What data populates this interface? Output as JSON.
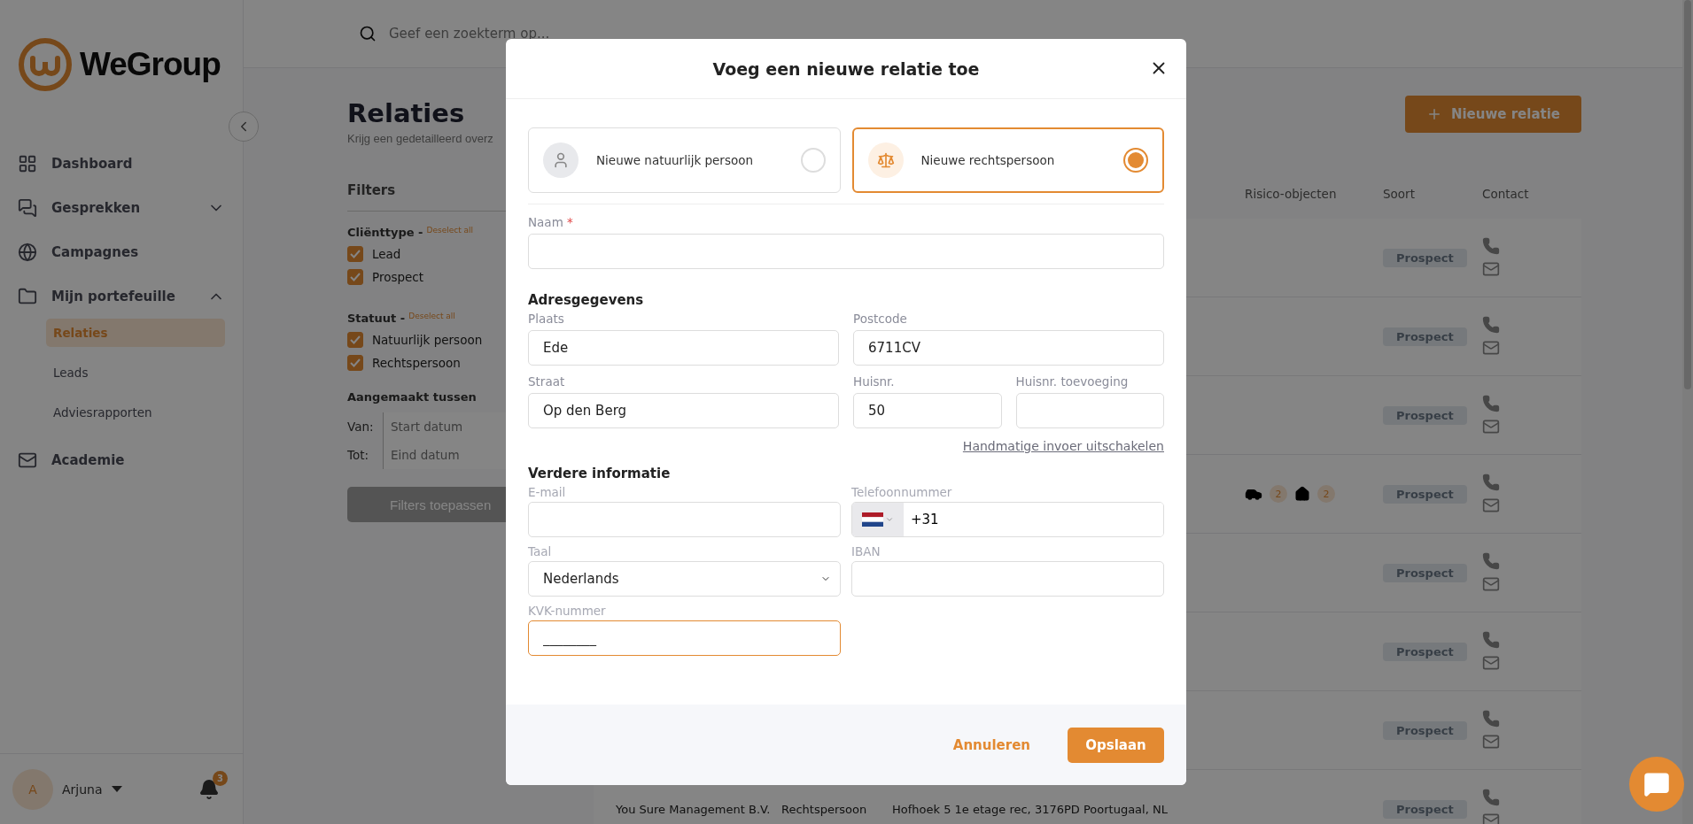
{
  "sidebar": {
    "logo": "WeGroup",
    "items": [
      {
        "kind": "dashboard",
        "label": "Dashboard",
        "selected": false
      },
      {
        "kind": "chats",
        "label": "Gesprekken",
        "selected": false,
        "expanded": false
      },
      {
        "kind": "globe",
        "label": "Campagnes",
        "selected": false
      },
      {
        "kind": "folder",
        "label": "Mijn portefeuille",
        "selected": false,
        "expanded": true,
        "children": [
          {
            "label": "Relaties",
            "selected": true
          },
          {
            "label": "Leads",
            "selected": false
          },
          {
            "label": "Adviesrapporten",
            "selected": false
          }
        ]
      },
      {
        "kind": "academy",
        "label": "Academie",
        "selected": false
      }
    ],
    "user": {
      "initial": "A",
      "name": "Arjuna"
    },
    "notifications": "3"
  },
  "search": {
    "placeholder": "Geef een zoekterm op..."
  },
  "page": {
    "title": "Relaties",
    "subtitle": "Krijg een gedetailleerd overz",
    "new_button": "Nieuwe relatie"
  },
  "filters": {
    "title": "Filters",
    "groups": [
      {
        "title": "Cliënttype -",
        "deselect": "Deselect all",
        "options": [
          {
            "label": "Lead",
            "checked": true
          },
          {
            "label": "Prospect",
            "checked": true
          }
        ]
      },
      {
        "title": "Statuut -",
        "deselect": "Deselect all",
        "options": [
          {
            "label": "Natuurlijk persoon",
            "checked": true
          },
          {
            "label": "Rechtspersoon",
            "checked": true
          }
        ]
      }
    ],
    "date_title": "Aangemaakt tussen",
    "dates": [
      {
        "label": "Van:",
        "placeholder": "Start datum"
      },
      {
        "label": "Tot:",
        "placeholder": "Eind datum"
      }
    ],
    "apply": "Filters toepassen"
  },
  "table": {
    "columns": [
      "Risico-objecten",
      "Soort",
      "Contact"
    ],
    "rows": [
      {
        "soort": "Prospect"
      },
      {
        "soort": "Prospect"
      },
      {
        "soort": "Prospect"
      },
      {
        "soort": "Prospect",
        "risks": [
          {
            "kind": "car",
            "count": "2"
          },
          {
            "kind": "house",
            "count": "2"
          }
        ]
      },
      {
        "soort": "Prospect"
      },
      {
        "soort": "Prospect"
      },
      {
        "soort": "Prospect"
      },
      {
        "name": "You Sure Management B.V.",
        "type": "Rechtspersoon",
        "address": "Hofhoek 5 1e etage rec, 3176PD Poortugaal, NL",
        "soort": "Prospect"
      }
    ]
  },
  "modal": {
    "title": "Voeg een nieuwe relatie toe",
    "choices": [
      {
        "kind": "person",
        "label": "Nieuwe natuurlijk persoon",
        "selected": false
      },
      {
        "kind": "company",
        "label": "Nieuwe rechtspersoon",
        "selected": true
      }
    ],
    "name_field": {
      "label": "Naam",
      "required_mark": "*"
    },
    "address": {
      "title": "Adresgegevens",
      "fields": [
        {
          "kind": "wide",
          "label": "Plaats",
          "value": "Ede"
        },
        {
          "kind": "wide",
          "label": "Postcode",
          "value": "6711CV"
        },
        {
          "kind": "wide",
          "label": "Straat",
          "value": "Op den Berg"
        },
        {
          "kind": "narrow",
          "label": "Huisnr.",
          "value": "50"
        },
        {
          "kind": "narrow",
          "label": "Huisnr. toevoeging"
        }
      ],
      "link": "Handmatige invoer uitschakelen"
    },
    "more": {
      "title": "Verdere informatie",
      "fields": [
        {
          "kind": "text",
          "label": "E-mail",
          "focused": false
        },
        {
          "kind": "phone",
          "label": "Telefoonnummer",
          "value": "+31",
          "focused": false
        },
        {
          "kind": "select",
          "label": "Taal",
          "value": "Nederlands",
          "focused": false
        },
        {
          "kind": "text",
          "label": "IBAN",
          "focused": false
        },
        {
          "kind": "text",
          "label": "KVK-nummer",
          "value": "________",
          "focused": true
        }
      ]
    },
    "cancel": "Annuleren",
    "save": "Opslaan"
  }
}
